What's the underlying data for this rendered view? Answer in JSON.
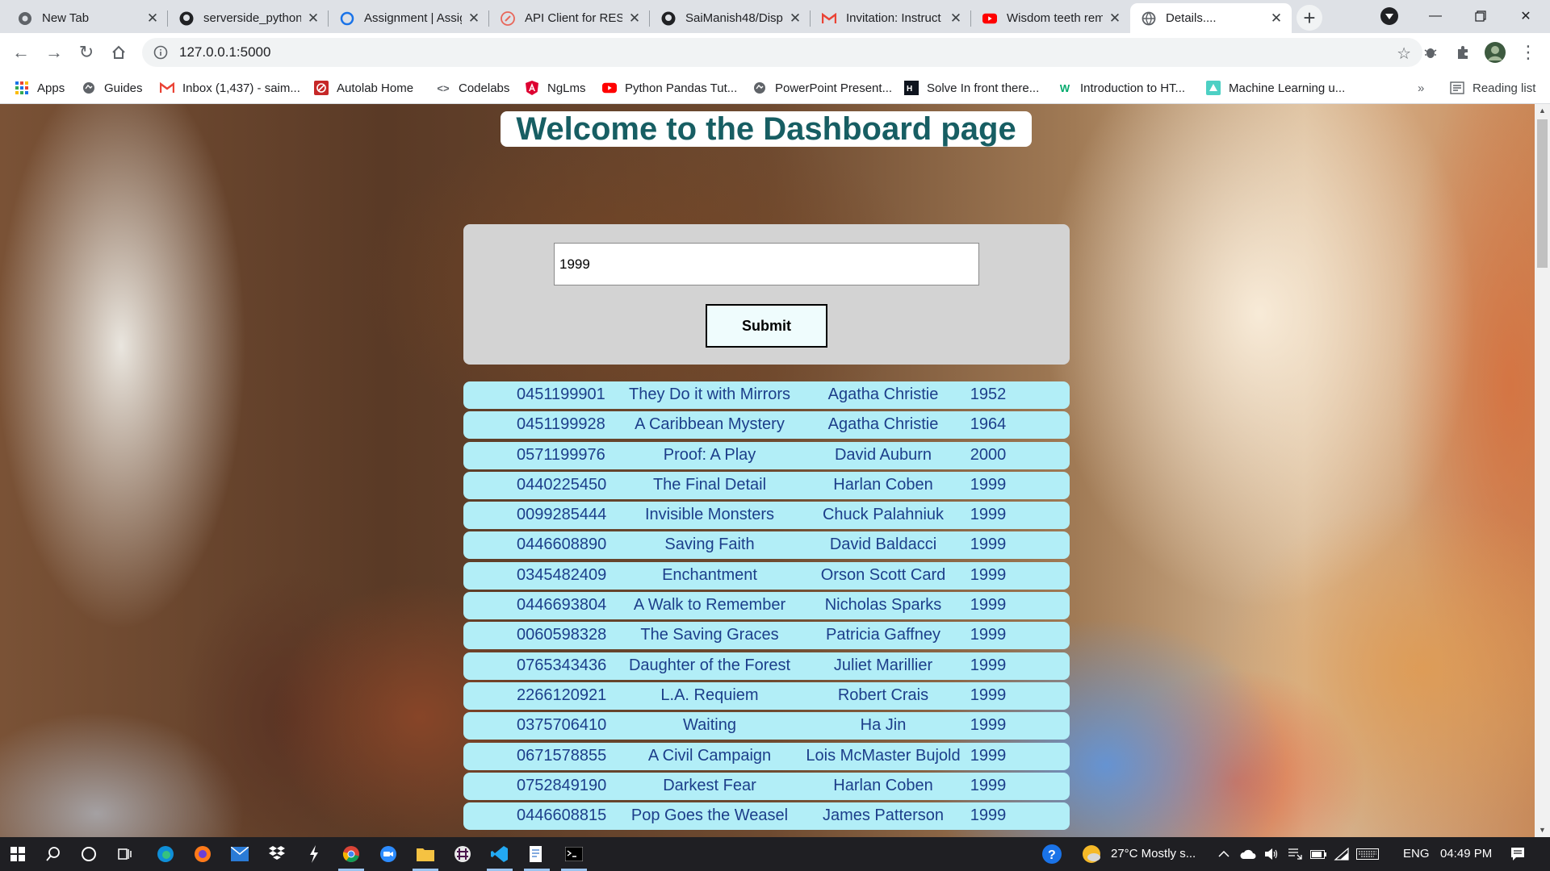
{
  "browser": {
    "tabs": [
      {
        "title": "New Tab",
        "icon": "chrome-icon"
      },
      {
        "title": "serverside_python",
        "icon": "github-icon"
      },
      {
        "title": "Assignment | Assig",
        "icon": "circle-icon"
      },
      {
        "title": "API Client for RES",
        "icon": "api-icon"
      },
      {
        "title": "SaiManish48/Disp",
        "icon": "github-icon"
      },
      {
        "title": "Invitation: Instruct",
        "icon": "gmail-icon"
      },
      {
        "title": "Wisdom teeth rem",
        "icon": "youtube-icon"
      },
      {
        "title": "Details....",
        "icon": "globe-icon"
      }
    ],
    "url": "127.0.0.1:5000",
    "bookmarks": [
      {
        "label": "Apps",
        "icon": "apps-grid-icon"
      },
      {
        "label": "Guides",
        "icon": "globe-icon"
      },
      {
        "label": "Inbox (1,437) - saim...",
        "icon": "gmail-icon"
      },
      {
        "label": "Autolab Home",
        "icon": "autolab-icon"
      },
      {
        "label": "Codelabs",
        "icon": "code-icon"
      },
      {
        "label": "NgLms",
        "icon": "angular-icon"
      },
      {
        "label": "Python Pandas Tut...",
        "icon": "youtube-icon"
      },
      {
        "label": "PowerPoint Present...",
        "icon": "globe-icon"
      },
      {
        "label": "Solve In front there...",
        "icon": "hackerrank-icon"
      },
      {
        "label": "Introduction to HT...",
        "icon": "w3-icon"
      },
      {
        "label": "Machine Learning u...",
        "icon": "ml-icon"
      }
    ],
    "overflow_label": "»",
    "reading_list_label": "Reading list"
  },
  "page": {
    "heading": "Welcome to the Dashboard page",
    "search_value": "1999",
    "submit_label": "Submit",
    "books": [
      {
        "isbn": "0451199901",
        "title": "They Do it with Mirrors",
        "author": "Agatha Christie",
        "year": "1952"
      },
      {
        "isbn": "0451199928",
        "title": "A Caribbean Mystery",
        "author": "Agatha Christie",
        "year": "1964"
      },
      {
        "isbn": "0571199976",
        "title": "Proof: A Play",
        "author": "David Auburn",
        "year": "2000"
      },
      {
        "isbn": "0440225450",
        "title": "The Final Detail",
        "author": "Harlan Coben",
        "year": "1999"
      },
      {
        "isbn": "0099285444",
        "title": "Invisible Monsters",
        "author": "Chuck Palahniuk",
        "year": "1999"
      },
      {
        "isbn": "0446608890",
        "title": "Saving Faith",
        "author": "David Baldacci",
        "year": "1999"
      },
      {
        "isbn": "0345482409",
        "title": "Enchantment",
        "author": "Orson Scott Card",
        "year": "1999"
      },
      {
        "isbn": "0446693804",
        "title": "A Walk to Remember",
        "author": "Nicholas Sparks",
        "year": "1999"
      },
      {
        "isbn": "0060598328",
        "title": "The Saving Graces",
        "author": "Patricia Gaffney",
        "year": "1999"
      },
      {
        "isbn": "0765343436",
        "title": "Daughter of the Forest",
        "author": "Juliet Marillier",
        "year": "1999"
      },
      {
        "isbn": "2266120921",
        "title": "L.A. Requiem",
        "author": "Robert Crais",
        "year": "1999"
      },
      {
        "isbn": "0375706410",
        "title": "Waiting",
        "author": "Ha Jin",
        "year": "1999"
      },
      {
        "isbn": "0671578855",
        "title": "A Civil Campaign",
        "author": "Lois McMaster Bujold",
        "year": "1999"
      },
      {
        "isbn": "0752849190",
        "title": "Darkest Fear",
        "author": "Harlan Coben",
        "year": "1999"
      },
      {
        "isbn": "0446608815",
        "title": "Pop Goes the Weasel",
        "author": "James Patterson",
        "year": "1999"
      }
    ]
  },
  "taskbar": {
    "weather": "27°C  Mostly s...",
    "language": "ENG",
    "time": "04:49 PM"
  },
  "colors": {
    "heading": "#175e63",
    "row_bg": "#b2eef7",
    "row_text": "#1c3e8a",
    "form_bg": "#d3d3d3",
    "submit_bg": "#effcfd"
  }
}
